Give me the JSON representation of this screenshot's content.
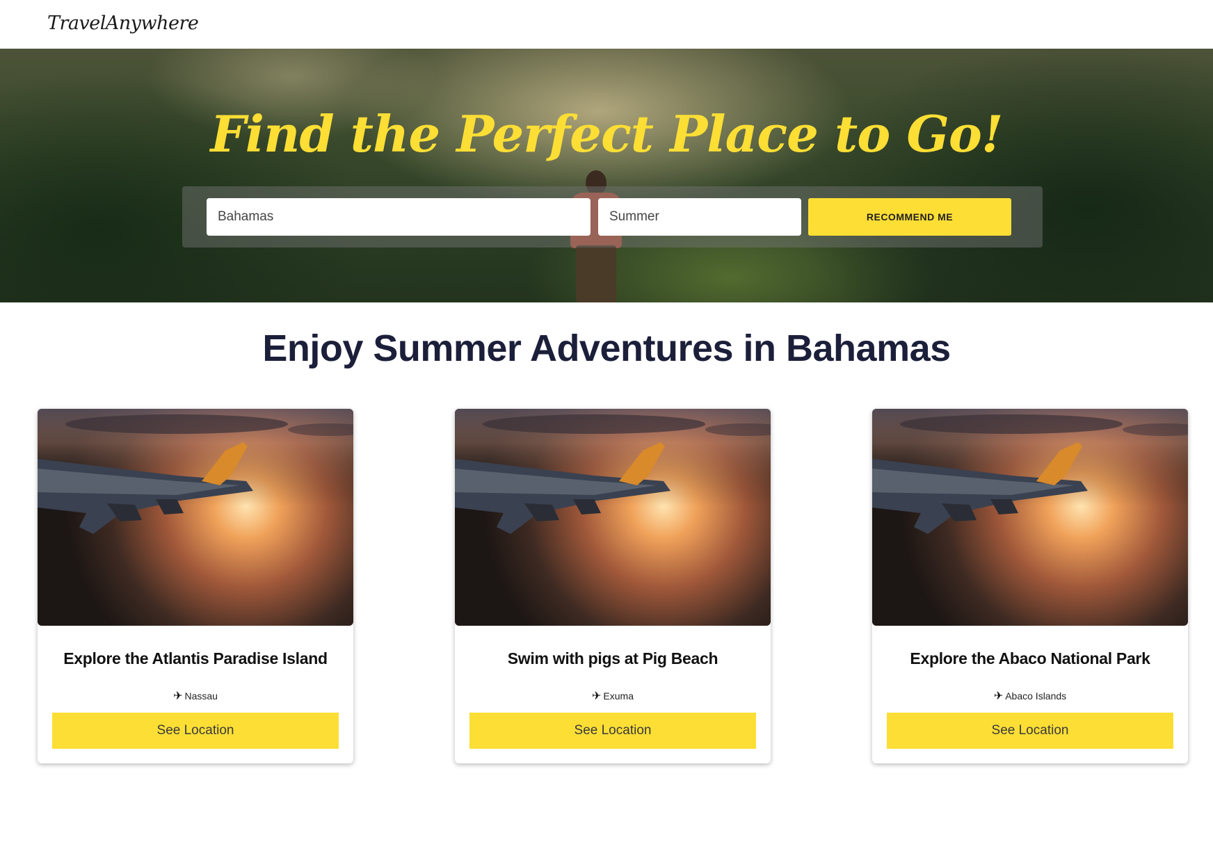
{
  "header": {
    "logo_text": "TravelAnywhere"
  },
  "hero": {
    "title": "Find the Perfect Place to Go!",
    "place_input_value": "Bahamas",
    "season_input_value": "Summer",
    "recommend_button_label": "RECOMMEND ME",
    "accent_color": "#fcde35"
  },
  "section": {
    "heading": "Enjoy Summer Adventures in Bahamas"
  },
  "cards": [
    {
      "title": "Explore the Atlantis Paradise Island",
      "location": "Nassau",
      "location_icon": "airplane-icon",
      "button_label": "See Location"
    },
    {
      "title": "Swim with pigs at Pig Beach",
      "location": "Exuma",
      "location_icon": "airplane-icon",
      "button_label": "See Location"
    },
    {
      "title": "Explore the Abaco National Park",
      "location": "Abaco Islands",
      "location_icon": "airplane-icon",
      "button_label": "See Location"
    }
  ],
  "colors": {
    "accent": "#fcde35",
    "heading": "#1c1f3a"
  }
}
